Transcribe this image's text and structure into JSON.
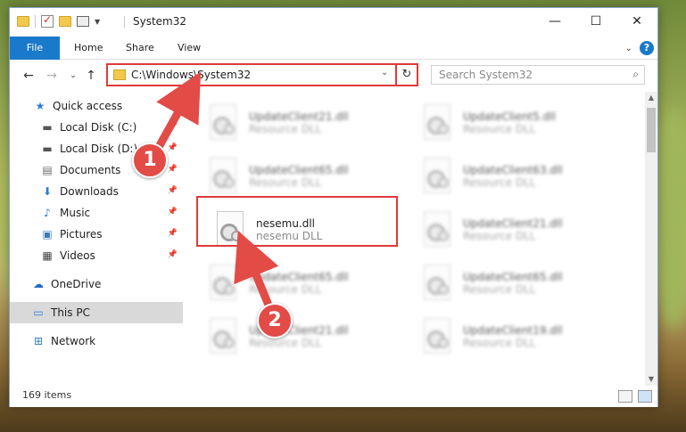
{
  "window": {
    "title": "System32",
    "controls": {
      "minimize": "—",
      "maximize": "☐",
      "close": "✕"
    }
  },
  "ribbon": {
    "tabs": [
      "File",
      "Home",
      "Share",
      "View"
    ],
    "help": "?"
  },
  "address": {
    "path": "C:\\Windows\\System32",
    "search_placeholder": "Search System32"
  },
  "sidebar": {
    "items": [
      {
        "label": "Quick access",
        "icon": "star-icon"
      },
      {
        "label": "Local Disk (C:)",
        "icon": "drive-icon",
        "pinned": true
      },
      {
        "label": "Local Disk (D:)",
        "icon": "drive-icon",
        "pinned": true
      },
      {
        "label": "Documents",
        "icon": "documents-icon",
        "pinned": true
      },
      {
        "label": "Downloads",
        "icon": "download-icon",
        "pinned": true
      },
      {
        "label": "Music",
        "icon": "music-icon",
        "pinned": true
      },
      {
        "label": "Pictures",
        "icon": "pictures-icon",
        "pinned": true
      },
      {
        "label": "Videos",
        "icon": "videos-icon",
        "pinned": true
      },
      {
        "label": "OneDrive",
        "icon": "cloud-icon"
      },
      {
        "label": "This PC",
        "icon": "computer-icon",
        "selected": true
      },
      {
        "label": "Network",
        "icon": "network-icon"
      }
    ]
  },
  "files": {
    "left": [
      {
        "name": "UpdateClient21.dll",
        "type": "Resource DLL"
      },
      {
        "name": "UpdateClient65.dll",
        "type": "Resource DLL"
      },
      {
        "name": "nesemu.dll",
        "type": "nesemu DLL"
      },
      {
        "name": "UpdateClient65.dll",
        "type": "Resource DLL"
      },
      {
        "name": "UpdateClient21.dll",
        "type": "Resource DLL"
      }
    ],
    "right": [
      {
        "name": "UpdateClient5.dll",
        "type": "Resource DLL"
      },
      {
        "name": "UpdateClient63.dll",
        "type": "Resource DLL"
      },
      {
        "name": "UpdateClient21.dll",
        "type": "Resource DLL"
      },
      {
        "name": "UpdateClient65.dll",
        "type": "Resource DLL"
      },
      {
        "name": "UpdateClient19.dll",
        "type": "Resource DLL"
      }
    ]
  },
  "status": {
    "items": "169 items"
  },
  "annotations": {
    "badge1": "1",
    "badge2": "2",
    "color": "#e34b46"
  }
}
